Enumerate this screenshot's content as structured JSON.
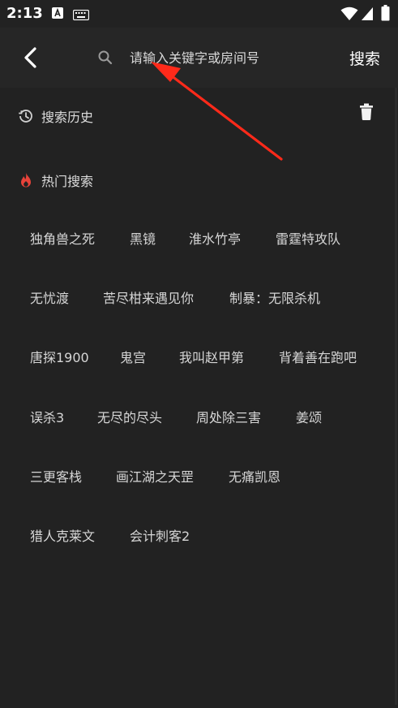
{
  "status_bar": {
    "time": "2:13",
    "icons": [
      "a-notification-icon",
      "keyboard-icon",
      "wifi-icon",
      "signal-icon",
      "battery-icon"
    ]
  },
  "header": {
    "back_icon": "chevron-left-icon",
    "search_icon": "magnifier-icon",
    "search_placeholder": "请输入关键字或房间号",
    "search_value": "",
    "search_button": "搜索"
  },
  "history": {
    "icon": "history-clock-icon",
    "title": "搜索历史",
    "clear_icon": "trash-icon"
  },
  "hot": {
    "icon": "flame-icon",
    "icon_color": "#e8433a",
    "title": "热门搜索",
    "rows": [
      [
        "独角兽之死",
        "黑镜",
        "淮水竹亭",
        "雷霆特攻队"
      ],
      [
        "无忧渡",
        "苦尽柑来遇见你",
        "制暴：无限杀机"
      ],
      [
        "唐探1900",
        "鬼宫",
        "我叫赵甲第",
        "背着善在跑吧"
      ],
      [
        "误杀3",
        "无尽的尽头",
        "周处除三害",
        "姜颂"
      ],
      [
        "三更客栈",
        "画江湖之天罡",
        "无痛凯恩"
      ],
      [
        "猎人克莱文",
        "会计刺客2"
      ]
    ]
  },
  "annotation": {
    "arrow_color": "#ff2a1a"
  },
  "colors": {
    "background": "#222222",
    "header": "#262626",
    "text": "#d6d6d6"
  }
}
